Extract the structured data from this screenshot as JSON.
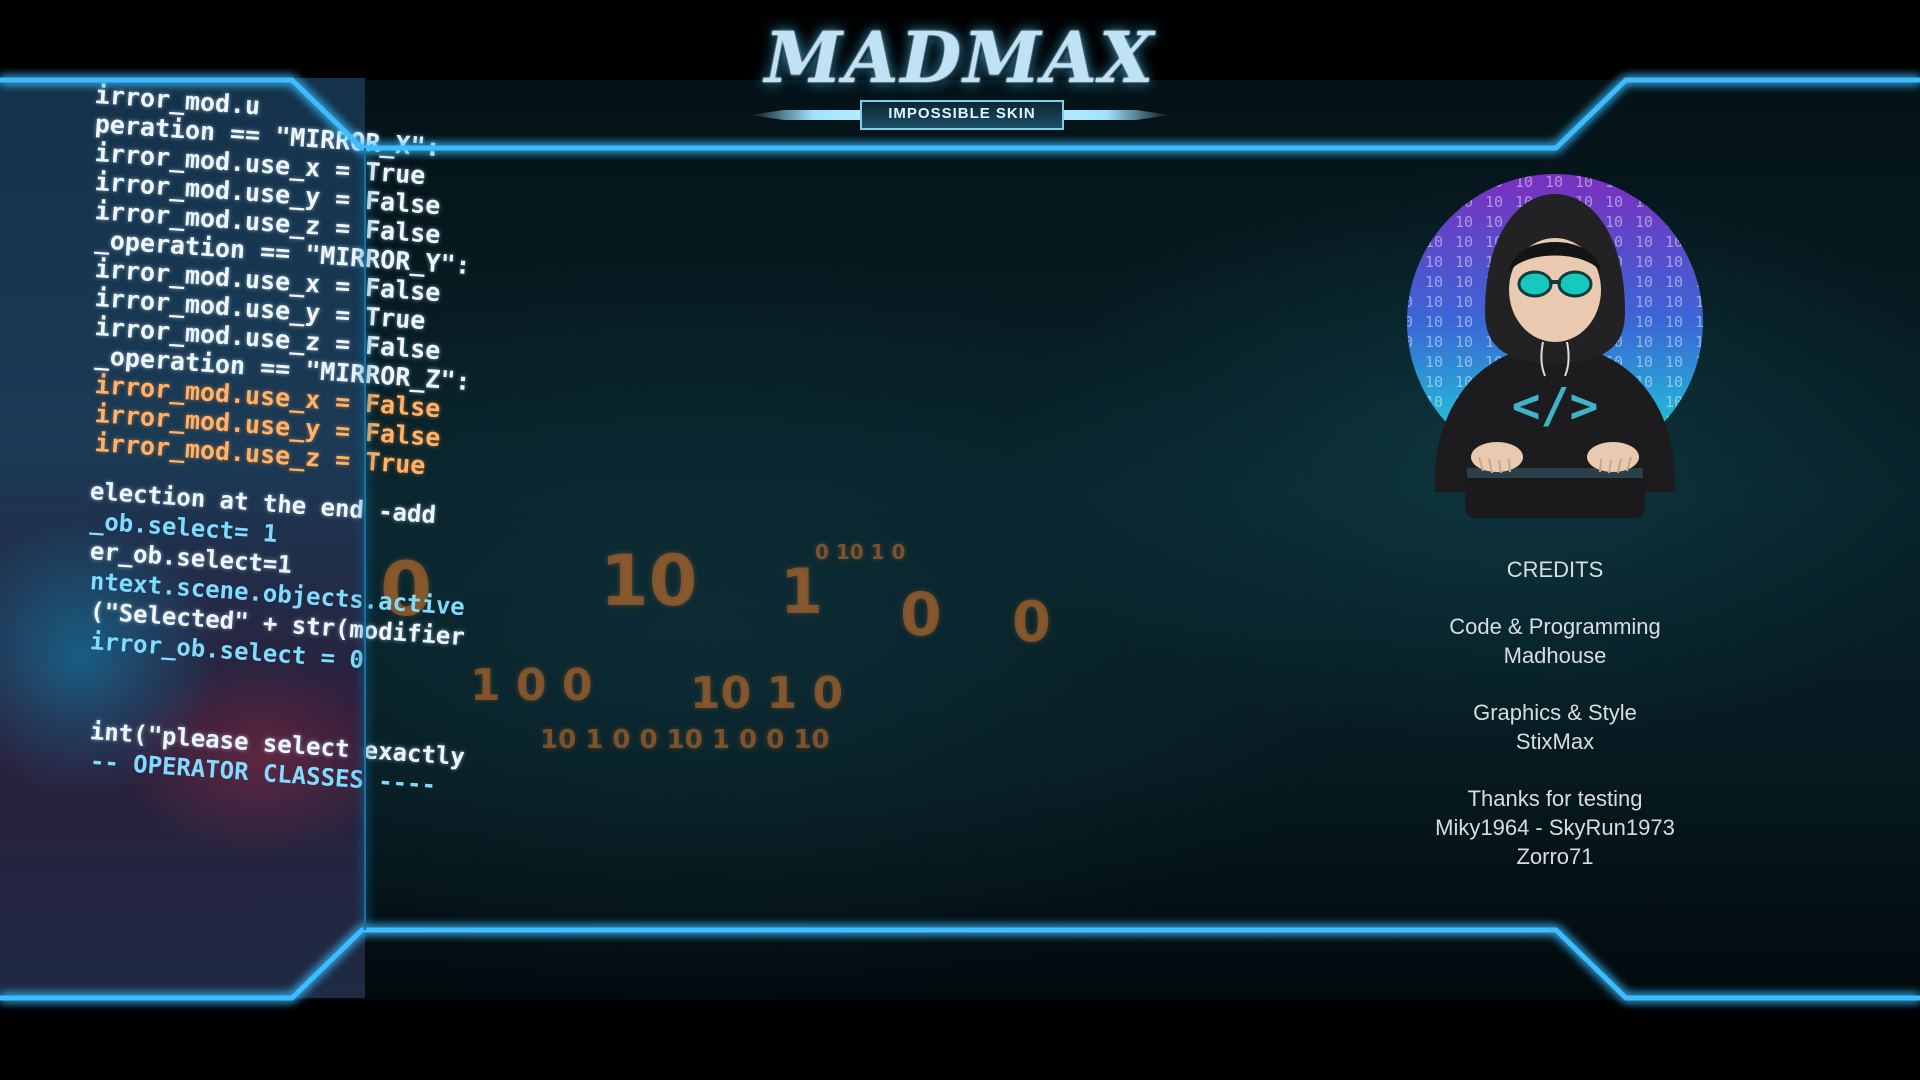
{
  "logo": {
    "title": "MADMAX",
    "subtitle": "IMPOSSIBLE SKIN",
    "icon": "madmax-logo"
  },
  "avatar": {
    "icon": "hooded-hacker-icon",
    "code_symbol": "</>"
  },
  "credits": {
    "heading": "CREDITS",
    "code_label": "Code & Programming",
    "code_name": "Madhouse",
    "graphics_label": "Graphics & Style",
    "graphics_name": "StixMax",
    "thanks_label": "Thanks for testing",
    "testers_line1": "Miky1964 - SkyRun1973",
    "testers_line2": "Zorro71"
  },
  "background_code": {
    "white_lines": [
      "irror_mod.u",
      "peration == \"MIRROR_X\":",
      "irror_mod.use_x = True",
      "irror_mod.use_y = False",
      "irror_mod.use_z = False",
      "_operation == \"MIRROR_Y\":",
      "irror_mod.use_x = False",
      "irror_mod.use_y = True",
      "irror_mod.use_z = False",
      "_operation == \"MIRROR_Z\":"
    ],
    "orange_lines": [
      "irror_mod.use_x = False",
      "irror_mod.use_y = False",
      "irror_mod.use_z = True"
    ],
    "lower_lines": [
      "election at the end -add",
      "_ob.select= 1",
      "er_ob.select=1",
      "ntext.scene.objects.active",
      "(\"Selected\" + str(modifier",
      "irror_ob.select = 0",
      "int(\"please select exactly",
      "-- OPERATOR CLASSES ----"
    ]
  },
  "colors": {
    "frame": "#33b6ff",
    "frame_glow": "#1e90ff",
    "credits_text": "#d8dde0",
    "digits": "#c06e2d"
  }
}
